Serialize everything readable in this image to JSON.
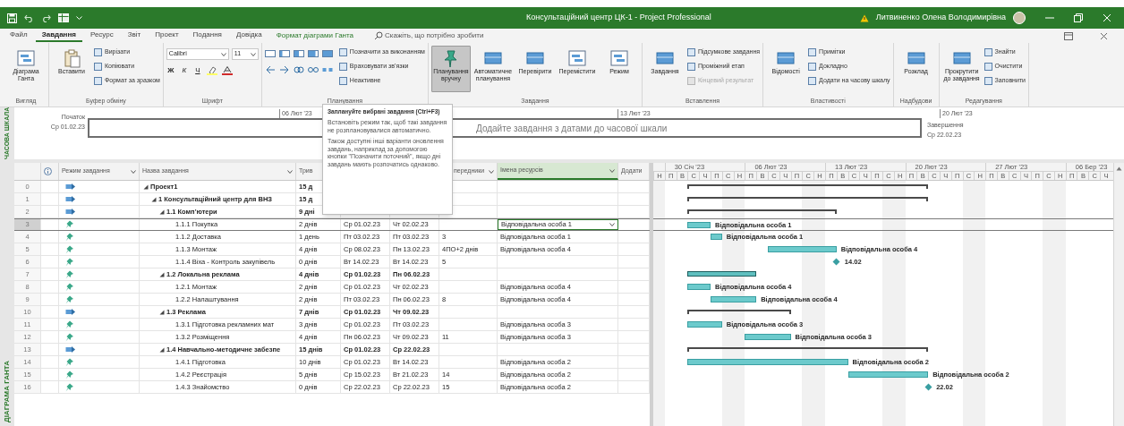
{
  "window": {
    "title": "Консультаційний центр ЦК-1 - Project Professional",
    "user": "Литвиненко Олена Володимирівна"
  },
  "ribbon": {
    "tabs": [
      {
        "label": "Файл",
        "selected": false
      },
      {
        "label": "Завдання",
        "selected": true
      },
      {
        "label": "Ресурс",
        "selected": false
      },
      {
        "label": "Звіт",
        "selected": false
      },
      {
        "label": "Проект",
        "selected": false
      },
      {
        "label": "Подання",
        "selected": false
      },
      {
        "label": "Довідка",
        "selected": false
      }
    ],
    "contextual_tab": "Формат діаграми Ганта",
    "search_placeholder": "Скажіть, що потрібно зробити",
    "groups": [
      {
        "label": "Вигляд",
        "items": [
          {
            "kind": "large",
            "label": "Діаграма Ганта",
            "selected": false
          }
        ]
      },
      {
        "label": "Буфер обміну",
        "items": [
          {
            "kind": "large",
            "label": "Вставити",
            "selected": false
          },
          {
            "kind": "small",
            "label": "Вирізати",
            "disabled": false
          },
          {
            "kind": "small",
            "label": "Копіювати",
            "disabled": false
          },
          {
            "kind": "small",
            "label": "Формат за зразком",
            "disabled": false
          }
        ]
      },
      {
        "label": "Шрифт",
        "items": [
          {
            "kind": "font",
            "font": "Calibri",
            "size": "11",
            "styles": [
              "Ж",
              "К",
              "Ч"
            ]
          }
        ]
      },
      {
        "label": "Планування",
        "items": [
          {
            "kind": "schedule_icons"
          },
          {
            "kind": "small",
            "label": "Позначити за виконанням",
            "disabled": false
          },
          {
            "kind": "small",
            "label": "Враховувати зв'язки",
            "disabled": false
          },
          {
            "kind": "small",
            "label": "Неактивне",
            "disabled": false
          }
        ]
      },
      {
        "label": "Завдання",
        "items": [
          {
            "kind": "large",
            "label": "Планування вручну",
            "selected": true
          },
          {
            "kind": "large",
            "label": "Автоматичне планування",
            "selected": false
          },
          {
            "kind": "large",
            "label": "Перевірити",
            "selected": false
          },
          {
            "kind": "large",
            "label": "Перемістити",
            "selected": false
          },
          {
            "kind": "large",
            "label": "Режим",
            "selected": false
          }
        ]
      },
      {
        "label": "Вставлення",
        "items": [
          {
            "kind": "large",
            "label": "Завдання",
            "selected": false
          },
          {
            "kind": "small",
            "label": "Підсумкове завдання",
            "disabled": false
          },
          {
            "kind": "small",
            "label": "Проміжний етап",
            "disabled": false
          },
          {
            "kind": "small",
            "label": "Кінцевий результат",
            "disabled": true
          }
        ]
      },
      {
        "label": "Властивості",
        "items": [
          {
            "kind": "large",
            "label": "Відомості",
            "selected": false
          },
          {
            "kind": "small",
            "label": "Примітки",
            "disabled": false
          },
          {
            "kind": "small",
            "label": "Докладно",
            "disabled": false
          },
          {
            "kind": "small",
            "label": "Додати на часову шкалу",
            "disabled": false
          }
        ]
      },
      {
        "label": "Надбудови",
        "items": [
          {
            "kind": "large",
            "label": "Розклад",
            "selected": false
          }
        ]
      },
      {
        "label": "Редагування",
        "items": [
          {
            "kind": "large",
            "label": "Прокрутити до завдання",
            "selected": false
          },
          {
            "kind": "small",
            "label": "Знайти",
            "disabled": false
          },
          {
            "kind": "small",
            "label": "Очистити",
            "disabled": false
          },
          {
            "kind": "small",
            "label": "Заповнити",
            "disabled": false
          }
        ]
      }
    ]
  },
  "timeline": {
    "side_label": "ЧАСОВА ШКАЛА",
    "start_label": "Початок",
    "start_date": "Ср 01.02.23",
    "finish_label": "Завершення",
    "finish_date": "Ср 22.02.23",
    "placeholder": "Додайте завдання з датами до часової шкали",
    "ticks": [
      "06 Лют '23",
      "13 Лют '23",
      "20 Лют '23"
    ]
  },
  "tooltip": {
    "title": "Заплануйте вибрані завдання (Ctrl+F3)",
    "paragraphs": [
      "Встановіть режим так, щоб такі завдання не розплановувалися автоматично.",
      "Також доступні інші варіанти оновлення завдань, наприклад за допомогою кнопки \"Позначити поточний\", якщо дні завдань мають розпочатись однаково."
    ]
  },
  "view_label": "ДІАГРАМА ГАНТА",
  "columns": {
    "mode": "Режим завдання",
    "name": "Назва завдання",
    "duration": "Трив",
    "predecessors": "передники",
    "resources": "Імена ресурсів",
    "add_column": "Додати"
  },
  "timescale": {
    "weeks": [
      "30 Січ '23",
      "06 Лют '23",
      "13 Лют '23",
      "20 Лют '23",
      "27 Лют '23",
      "06 Бер '23"
    ],
    "days": [
      "Н",
      "П",
      "В",
      "С",
      "Ч",
      "П",
      "С",
      "Н",
      "П",
      "В",
      "С",
      "Ч",
      "П",
      "С",
      "Н",
      "П",
      "В",
      "С",
      "Ч",
      "П",
      "С",
      "Н",
      "П",
      "В",
      "С",
      "Ч",
      "П",
      "С",
      "Н",
      "П",
      "В",
      "С",
      "Ч",
      "П",
      "С",
      "Н",
      "П",
      "В",
      "С",
      "Ч"
    ]
  },
  "tasks": [
    {
      "id": "0",
      "name": "Проект1",
      "kind": "summary",
      "manual": false,
      "duration": "15 д",
      "expanded": true,
      "selected": false,
      "children": [
        {
          "id": "1",
          "name": "1 Консультаційний центр для ВНЗ",
          "kind": "summary",
          "manual": false,
          "duration": "15 д",
          "expanded": true,
          "selected": false,
          "children": [
            {
              "id": "2",
              "name": "1.1 Комп'ютери",
              "kind": "summary",
              "manual": false,
              "duration": "9 дні",
              "expanded": true,
              "selected": false,
              "children": [
                {
                  "id": "3",
                  "name": "1.1.1 Покупка",
                  "kind": "task",
                  "manual": true,
                  "duration": "2 днів",
                  "start": "Ср 01.02.23",
                  "finish": "Чт 02.02.23",
                  "resources": "Відповідальна особа 1",
                  "bar_label": "Відповідальна особа 1",
                  "selected": true
                },
                {
                  "id": "4",
                  "name": "1.1.2 Доставка",
                  "kind": "task",
                  "manual": true,
                  "duration": "1 день",
                  "start": "Пт 03.02.23",
                  "finish": "Пт 03.02.23",
                  "predecessors": "3",
                  "resources": "Відповідальна особа 1",
                  "bar_label": "Відповідальна особа 1",
                  "selected": false
                },
                {
                  "id": "5",
                  "name": "1.1.3 Монтаж",
                  "kind": "task",
                  "manual": true,
                  "duration": "4 днів",
                  "start": "Ср 08.02.23",
                  "finish": "Пн 13.02.23",
                  "predecessors": "4ПО+2 днів",
                  "resources": "Відповідальна особа 4",
                  "bar_label": "Відповідальна особа 4",
                  "selected": false
                },
                {
                  "id": "6",
                  "name": "1.1.4 Віха - Контроль закупівель",
                  "kind": "milestone",
                  "manual": true,
                  "duration": "0 днів",
                  "start": "Вт 14.02.23",
                  "finish": "Вт 14.02.23",
                  "predecessors": "5",
                  "bar_label": "14.02",
                  "selected": false
                }
              ]
            },
            {
              "id": "7",
              "name": "1.2 Локальна реклама",
              "kind": "summary",
              "manual": true,
              "duration": "4 днів",
              "start": "Ср 01.02.23",
              "finish": "Пн 06.02.23",
              "expanded": true,
              "selected": false,
              "children": [
                {
                  "id": "8",
                  "name": "1.2.1 Монтаж",
                  "kind": "task",
                  "manual": true,
                  "duration": "2 днів",
                  "start": "Ср 01.02.23",
                  "finish": "Чт 02.02.23",
                  "resources": "Відповідальна особа 4",
                  "bar_label": "Відповідальна особа 4",
                  "selected": false
                },
                {
                  "id": "9",
                  "name": "1.2.2 Налаштування",
                  "kind": "task",
                  "manual": true,
                  "duration": "2 днів",
                  "start": "Пт 03.02.23",
                  "finish": "Пн 06.02.23",
                  "predecessors": "8",
                  "resources": "Відповідальна особа 4",
                  "bar_label": "Відповідальна особа 4",
                  "selected": false
                }
              ]
            },
            {
              "id": "10",
              "name": "1.3 Реклама",
              "kind": "summary",
              "manual": false,
              "duration": "7 днів",
              "start": "Ср 01.02.23",
              "finish": "Чт 09.02.23",
              "expanded": true,
              "selected": false,
              "children": [
                {
                  "id": "11",
                  "name": "1.3.1 Підготовка рекламних мат",
                  "kind": "task",
                  "manual": true,
                  "duration": "3 днів",
                  "start": "Ср 01.02.23",
                  "finish": "Пт 03.02.23",
                  "resources": "Відповідальна особа 3",
                  "bar_label": "Відповідальна особа 3",
                  "selected": false
                },
                {
                  "id": "12",
                  "name": "1.3.2 Розміщення",
                  "kind": "task",
                  "manual": true,
                  "duration": "4 днів",
                  "start": "Пн 06.02.23",
                  "finish": "Чт 09.02.23",
                  "predecessors": "11",
                  "resources": "Відповідальна особа 3",
                  "bar_label": "Відповідальна особа 3",
                  "selected": false
                }
              ]
            },
            {
              "id": "13",
              "name": "1.4 Навчально-методичне забезпе",
              "kind": "summary",
              "manual": false,
              "duration": "15 днів",
              "start": "Ср 01.02.23",
              "finish": "Ср 22.02.23",
              "expanded": true,
              "selected": false,
              "children": [
                {
                  "id": "14",
                  "name": "1.4.1 Підготовка",
                  "kind": "task",
                  "manual": true,
                  "duration": "10 днів",
                  "start": "Ср 01.02.23",
                  "finish": "Вт 14.02.23",
                  "resources": "Відповідальна особа 2",
                  "bar_label": "Відповідальна особа 2",
                  "selected": false
                },
                {
                  "id": "15",
                  "name": "1.4.2 Реєстрація",
                  "kind": "task",
                  "manual": true,
                  "duration": "5 днів",
                  "start": "Ср 15.02.23",
                  "finish": "Вт 21.02.23",
                  "predecessors": "14",
                  "resources": "Відповідальна особа 2",
                  "bar_label": "Відповідальна особа 2",
                  "selected": false
                },
                {
                  "id": "16",
                  "name": "1.4.3 Знайомство",
                  "kind": "milestone",
                  "manual": true,
                  "duration": "0 днів",
                  "start": "Ср 22.02.23",
                  "finish": "Ср 22.02.23",
                  "predecessors": "15",
                  "resources": "Відповідальна особа 2",
                  "bar_label": "22.02",
                  "selected": false
                }
              ]
            }
          ]
        }
      ]
    }
  ]
}
